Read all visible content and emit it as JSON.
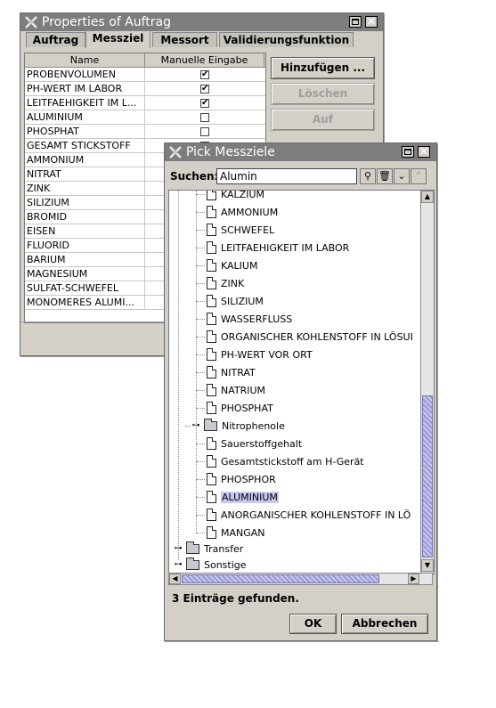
{
  "properties_window": {
    "title": "Properties of Auftrag",
    "tabs": [
      "Auftrag",
      "Messziel",
      "Messort",
      "Validierungsfunktion"
    ],
    "active_tab": "Messziel",
    "table": {
      "headers": [
        "Name",
        "Manuelle Eingabe"
      ],
      "rows": [
        {
          "name": "PROBENVOLUMEN",
          "checked": true
        },
        {
          "name": "PH-WERT IM LABOR",
          "checked": true
        },
        {
          "name": "LEITFAEHIGKEIT IM L...",
          "checked": true
        },
        {
          "name": "ALUMINIUM",
          "checked": false
        },
        {
          "name": "PHOSPHAT",
          "checked": false
        },
        {
          "name": "GESAMT STICKSTOFF",
          "checked": false
        },
        {
          "name": "AMMONIUM",
          "checked": false
        },
        {
          "name": "NITRAT",
          "checked": false
        },
        {
          "name": "ZINK",
          "checked": false
        },
        {
          "name": "SILIZIUM",
          "checked": false
        },
        {
          "name": "BROMID",
          "checked": false
        },
        {
          "name": "EISEN",
          "checked": false
        },
        {
          "name": "FLUORID",
          "checked": false
        },
        {
          "name": "BARIUM",
          "checked": false
        },
        {
          "name": "MAGNESIUM",
          "checked": false
        },
        {
          "name": "SULFAT-SCHWEFEL",
          "checked": false
        },
        {
          "name": "MONOMERES ALUMI...",
          "checked": false
        }
      ]
    },
    "buttons": {
      "add": "Hinzufügen ...",
      "delete": "Löschen",
      "up": "Auf"
    },
    "check_glyph": "✔"
  },
  "pick_dialog": {
    "title": "Pick Messziele",
    "search_label": "Suchen:",
    "search_value": "Alumin",
    "tree_items": [
      {
        "label": "KALZIUM",
        "type": "doc"
      },
      {
        "label": "AMMONIUM",
        "type": "doc"
      },
      {
        "label": "SCHWEFEL",
        "type": "doc"
      },
      {
        "label": "LEITFAEHIGKEIT IM LABOR",
        "type": "doc"
      },
      {
        "label": "KALIUM",
        "type": "doc"
      },
      {
        "label": "ZINK",
        "type": "doc"
      },
      {
        "label": "SILIZIUM",
        "type": "doc"
      },
      {
        "label": "WASSERFLUSS",
        "type": "doc"
      },
      {
        "label": "ORGANISCHER KOHLENSTOFF IN LÖSUI",
        "type": "doc"
      },
      {
        "label": "PH-WERT VOR ORT",
        "type": "doc"
      },
      {
        "label": "NITRAT",
        "type": "doc"
      },
      {
        "label": "NATRIUM",
        "type": "doc"
      },
      {
        "label": "PHOSPHAT",
        "type": "doc"
      },
      {
        "label": "Nitrophenole",
        "type": "folder"
      },
      {
        "label": "Sauerstoffgehalt",
        "type": "doc"
      },
      {
        "label": "Gesamtstickstoff am H-Gerät",
        "type": "doc"
      },
      {
        "label": "PHOSPHOR",
        "type": "doc"
      },
      {
        "label": "ALUMINIUM",
        "type": "doc",
        "selected": true
      },
      {
        "label": "ANORGANISCHER KOHLENSTOFF IN LÖ",
        "type": "doc"
      },
      {
        "label": "MANGAN",
        "type": "doc"
      }
    ],
    "root_items": [
      {
        "label": "Transfer",
        "type": "folder"
      },
      {
        "label": "Sonstige",
        "type": "folder"
      }
    ],
    "status": "3 Einträge gefunden.",
    "ok_label": "OK",
    "cancel_label": "Abbrechen"
  }
}
